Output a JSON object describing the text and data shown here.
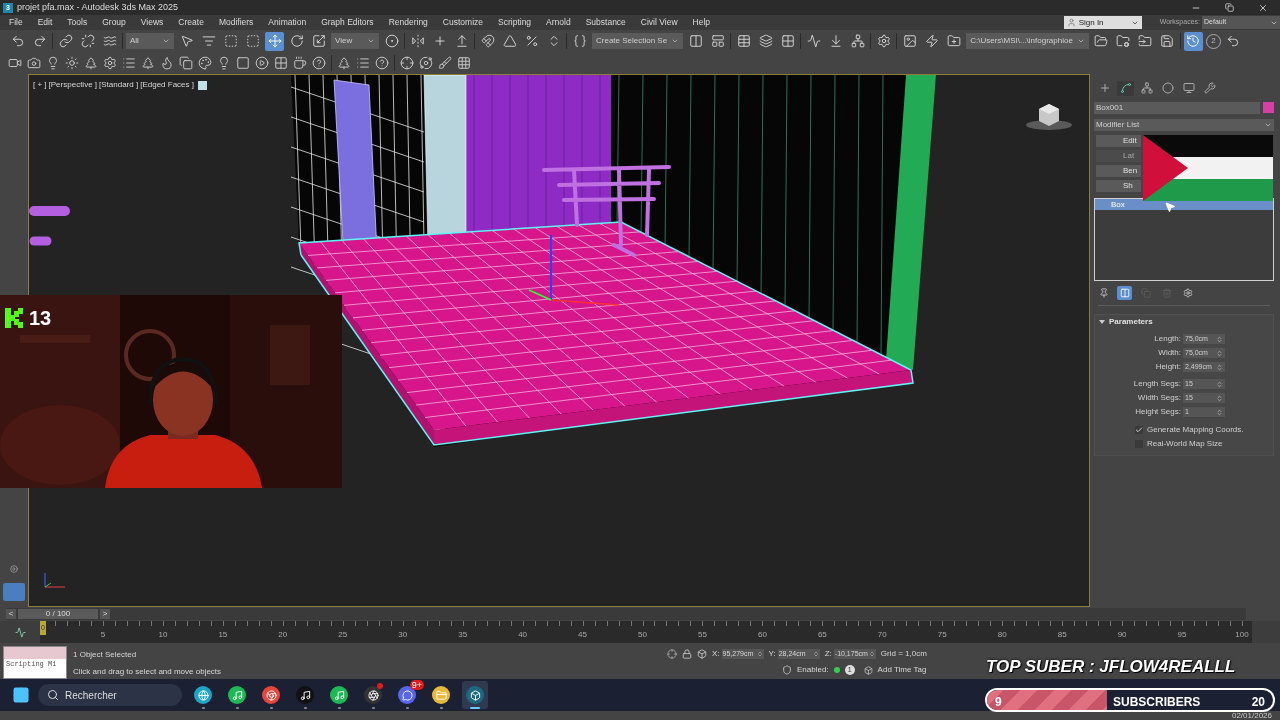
{
  "window": {
    "logo_text": "3",
    "title": "projet pfa.max - Autodesk 3ds Max 2025"
  },
  "menu": [
    "File",
    "Edit",
    "Tools",
    "Group",
    "Views",
    "Create",
    "Modifiers",
    "Animation",
    "Graph Editors",
    "Rendering",
    "Customize",
    "Scripting",
    "Arnold",
    "Substance",
    "Civil View",
    "Help"
  ],
  "account": {
    "sign_in": "Sign In",
    "workspaces_label": "Workspaces:",
    "workspace": "Default"
  },
  "main_toolbar": [
    {
      "kind": "button",
      "selected": false
    },
    {
      "kind": "button",
      "selected": false
    },
    {
      "kind": "separator"
    },
    {
      "kind": "button",
      "selected": false
    },
    {
      "kind": "button",
      "selected": false
    },
    {
      "kind": "button",
      "selected": false
    },
    {
      "kind": "separator"
    },
    {
      "kind": "dropdown",
      "value": "All"
    },
    {
      "kind": "button",
      "selected": false
    },
    {
      "kind": "button",
      "selected": false
    },
    {
      "kind": "button",
      "selected": false
    },
    {
      "kind": "button",
      "selected": false
    },
    {
      "kind": "button",
      "selected": true
    },
    {
      "kind": "button",
      "selected": false
    },
    {
      "kind": "button",
      "selected": false
    },
    {
      "kind": "dropdown",
      "value": "View"
    },
    {
      "kind": "button",
      "selected": false
    },
    {
      "kind": "separator"
    },
    {
      "kind": "button",
      "selected": false
    },
    {
      "kind": "button",
      "selected": false
    },
    {
      "kind": "button",
      "selected": false
    },
    {
      "kind": "separator"
    },
    {
      "kind": "button",
      "selected": false
    },
    {
      "kind": "button",
      "selected": false
    },
    {
      "kind": "button",
      "selected": false
    },
    {
      "kind": "button",
      "selected": false
    },
    {
      "kind": "separator"
    },
    {
      "kind": "button",
      "selected": false
    },
    {
      "kind": "dropdown",
      "value": "Create Selection Se"
    },
    {
      "kind": "button",
      "selected": false
    },
    {
      "kind": "button",
      "selected": false
    },
    {
      "kind": "separator"
    },
    {
      "kind": "button",
      "selected": false
    },
    {
      "kind": "button",
      "selected": false
    },
    {
      "kind": "button",
      "selected": false
    },
    {
      "kind": "separator"
    },
    {
      "kind": "button",
      "selected": false
    },
    {
      "kind": "button",
      "selected": false
    },
    {
      "kind": "button",
      "selected": false
    },
    {
      "kind": "separator"
    },
    {
      "kind": "button",
      "selected": false
    },
    {
      "kind": "separator"
    },
    {
      "kind": "button",
      "selected": false
    },
    {
      "kind": "button",
      "selected": false
    },
    {
      "kind": "button",
      "selected": false
    },
    {
      "kind": "dropdown",
      "value": "C:\\Users\\MSI\\...\\infographioe"
    },
    {
      "kind": "button",
      "selected": false
    },
    {
      "kind": "button",
      "selected": false
    },
    {
      "kind": "button",
      "selected": false
    },
    {
      "kind": "button",
      "selected": false
    },
    {
      "kind": "separator"
    },
    {
      "kind": "button",
      "selected": true
    },
    {
      "kind": "badge",
      "value": "2"
    },
    {
      "kind": "button",
      "selected": false
    }
  ],
  "viewport": {
    "labels": [
      "[ + ]",
      "[Perspective ]",
      "[Standard ]",
      "[Edged Faces ]"
    ]
  },
  "stream_overlay": {
    "viewer_count": "13",
    "banner": "TOP SUBER : JFLOW4REALLL",
    "goal": {
      "current": "9",
      "label": "SUBSCRIBERS",
      "target": "20",
      "level": 0.42
    }
  },
  "command_panel": {
    "tabs": [
      {
        "selected": false
      },
      {
        "selected": true
      },
      {
        "selected": false
      },
      {
        "selected": false
      },
      {
        "selected": false
      },
      {
        "selected": false
      }
    ],
    "object_name": "Box001",
    "modifier_list": "Modifier List",
    "modifier_buttons": [
      {
        "label": "Edit",
        "disabled": false
      },
      {
        "label": "Lat",
        "disabled": true
      },
      {
        "label": "Ben",
        "disabled": false
      },
      {
        "label": "Sh",
        "disabled": false
      }
    ],
    "stack": [
      {
        "label": "Box",
        "selected": true
      }
    ],
    "stack_tools": [
      {
        "selected": false,
        "disabled": false
      },
      {
        "selected": true,
        "disabled": false
      },
      {
        "selected": false,
        "disabled": true
      },
      {
        "selected": false,
        "disabled": true
      },
      {
        "selected": false,
        "disabled": false
      }
    ],
    "rollout": {
      "title": "Parameters",
      "expanded": true,
      "groups": [
        [
          {
            "label": "Length:",
            "value": "75,0cm"
          },
          {
            "label": "Width:",
            "value": "75,0cm"
          },
          {
            "label": "Height:",
            "value": "2,499cm"
          }
        ],
        [
          {
            "label": "Length Segs:",
            "value": "15"
          },
          {
            "label": "Width Segs:",
            "value": "15"
          },
          {
            "label": "Height Segs:",
            "value": "1"
          }
        ]
      ],
      "options": [
        {
          "label": "Generate Mapping Coords.",
          "checked": true
        },
        {
          "label": "Real-World Map Size",
          "checked": false
        }
      ]
    }
  },
  "time_slider": {
    "prev": "<",
    "position": "0 / 100",
    "next": ">",
    "level": 0,
    "frame": "0",
    "ticks": [
      "5",
      "10",
      "15",
      "20",
      "25",
      "30",
      "35",
      "40",
      "45",
      "50",
      "55",
      "60",
      "65",
      "70",
      "75",
      "80",
      "85",
      "90",
      "95",
      "100"
    ]
  },
  "status_bar": {
    "listener": "Scripting Mi",
    "selection": "1 Object Selected",
    "prompt": "Click and drag to select and move objects",
    "coords": [
      {
        "axis": "X:",
        "value": "95,279cm"
      },
      {
        "axis": "Y:",
        "value": "28,24cm"
      },
      {
        "axis": "Z:",
        "value": "-10,175cm"
      }
    ],
    "grid": "Grid = 1,0cm",
    "enabled_label": "Enabled:",
    "enabled": true,
    "time_tag_count": "1",
    "time_tag": "Add Time Tag"
  },
  "taskbar": {
    "search": "Rechercher",
    "apps": [
      {
        "notification": false,
        "active": false
      },
      {
        "notification": false,
        "active": false
      },
      {
        "notification": false,
        "active": false
      },
      {
        "notification": false,
        "active": false
      },
      {
        "notification": false,
        "active": false
      },
      {
        "notification": true,
        "active": false
      },
      {
        "badge": "9+",
        "notification": false,
        "active": false
      },
      {
        "notification": false,
        "active": false
      },
      {
        "notification": false,
        "active": true
      }
    ],
    "date": "02/01/2026"
  }
}
